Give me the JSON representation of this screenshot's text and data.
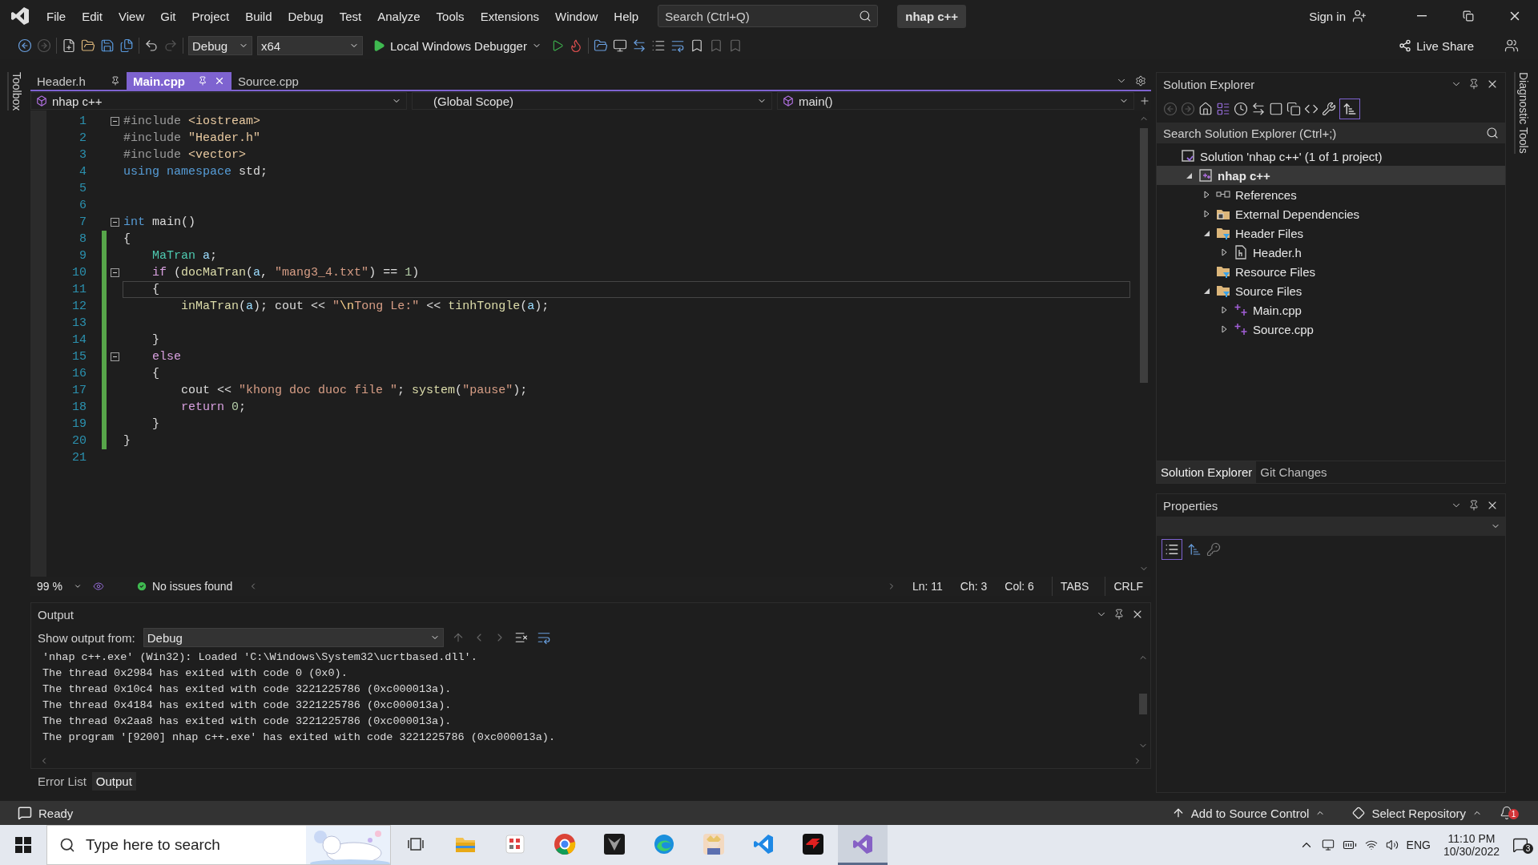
{
  "menu": [
    "File",
    "Edit",
    "View",
    "Git",
    "Project",
    "Build",
    "Debug",
    "Test",
    "Analyze",
    "Tools",
    "Extensions",
    "Window",
    "Help"
  ],
  "search": {
    "placeholder": "Search (Ctrl+Q)"
  },
  "solution_badge": "nhap c++",
  "sign_in": "Sign in",
  "toolbar": {
    "configuration": "Debug",
    "platform": "x64",
    "run": "Local Windows Debugger",
    "live_share": "Live Share"
  },
  "side_tabs": {
    "left": "Toolbox",
    "right": "Diagnostic Tools"
  },
  "editor": {
    "tabs": [
      {
        "label": "Header.h",
        "selected": false,
        "pinned": true
      },
      {
        "label": "Main.cpp",
        "selected": true,
        "pinned": true
      },
      {
        "label": "Source.cpp",
        "selected": false,
        "pinned": false
      }
    ],
    "project_scope": "nhap c++",
    "scope": "(Global Scope)",
    "member": "main()",
    "lines": [
      {
        "number": "1",
        "fold": true,
        "changed": false,
        "current": false,
        "tokens": [
          {
            "text": "#include ",
            "kind": "pre"
          },
          {
            "text": "<iostream>",
            "kind": "inc"
          }
        ]
      },
      {
        "number": "2",
        "fold": false,
        "changed": false,
        "current": false,
        "tokens": [
          {
            "text": "#include ",
            "kind": "pre"
          },
          {
            "text": "\"Header.h\"",
            "kind": "inc"
          }
        ]
      },
      {
        "number": "3",
        "fold": false,
        "changed": false,
        "current": false,
        "tokens": [
          {
            "text": "#include ",
            "kind": "pre"
          },
          {
            "text": "<vector>",
            "kind": "inc"
          }
        ]
      },
      {
        "number": "4",
        "fold": false,
        "changed": false,
        "current": false,
        "tokens": [
          {
            "text": "using namespace",
            "kind": "kw"
          },
          {
            "text": " std;",
            "kind": "txt"
          }
        ]
      },
      {
        "number": "5",
        "fold": false,
        "changed": false,
        "current": false
      },
      {
        "number": "6",
        "fold": false,
        "changed": false,
        "current": false
      },
      {
        "number": "7",
        "fold": true,
        "changed": false,
        "current": false,
        "tokens": [
          {
            "text": "int",
            "kind": "kw"
          },
          {
            "text": " main()",
            "kind": "txt"
          }
        ]
      },
      {
        "number": "8",
        "fold": false,
        "changed": true,
        "current": false,
        "tokens": [
          {
            "text": "{",
            "kind": "txt"
          }
        ]
      },
      {
        "number": "9",
        "fold": false,
        "changed": true,
        "current": false,
        "tokens": [
          {
            "text": "    MaTran",
            "kind": "type"
          },
          {
            "text": " a",
            "kind": "var"
          },
          {
            "text": ";",
            "kind": "txt"
          }
        ]
      },
      {
        "number": "10",
        "fold": true,
        "changed": true,
        "current": false,
        "tokens": [
          {
            "text": "    if",
            "kind": "ctl"
          },
          {
            "text": " (",
            "kind": "txt"
          },
          {
            "text": "docMaTran",
            "kind": "fn"
          },
          {
            "text": "(",
            "kind": "txt"
          },
          {
            "text": "a",
            "kind": "var"
          },
          {
            "text": ", ",
            "kind": "txt"
          },
          {
            "text": "\"mang3_4.txt\"",
            "kind": "str"
          },
          {
            "text": ") == ",
            "kind": "txt"
          },
          {
            "text": "1",
            "kind": "num"
          },
          {
            "text": ")",
            "kind": "txt"
          }
        ]
      },
      {
        "number": "11",
        "fold": false,
        "changed": true,
        "current": true,
        "tokens": [
          {
            "text": "    {",
            "kind": "txt"
          }
        ]
      },
      {
        "number": "12",
        "fold": false,
        "changed": true,
        "current": false,
        "tokens": [
          {
            "text": "        inMaTran",
            "kind": "fn"
          },
          {
            "text": "(",
            "kind": "txt"
          },
          {
            "text": "a",
            "kind": "var"
          },
          {
            "text": "); cout << ",
            "kind": "txt"
          },
          {
            "text": "\"",
            "kind": "str"
          },
          {
            "text": "\\n",
            "kind": "esc"
          },
          {
            "text": "Tong Le:\"",
            "kind": "str"
          },
          {
            "text": " << ",
            "kind": "txt"
          },
          {
            "text": "tinhTongle",
            "kind": "fn"
          },
          {
            "text": "(",
            "kind": "txt"
          },
          {
            "text": "a",
            "kind": "var"
          },
          {
            "text": ");",
            "kind": "txt"
          }
        ]
      },
      {
        "number": "13",
        "fold": false,
        "changed": true,
        "current": false
      },
      {
        "number": "14",
        "fold": false,
        "changed": true,
        "current": false,
        "tokens": [
          {
            "text": "    }",
            "kind": "txt"
          }
        ]
      },
      {
        "number": "15",
        "fold": true,
        "changed": true,
        "current": false,
        "tokens": [
          {
            "text": "    else",
            "kind": "ctl"
          }
        ]
      },
      {
        "number": "16",
        "fold": false,
        "changed": true,
        "current": false,
        "tokens": [
          {
            "text": "    {",
            "kind": "txt"
          }
        ]
      },
      {
        "number": "17",
        "fold": false,
        "changed": true,
        "current": false,
        "tokens": [
          {
            "text": "        cout << ",
            "kind": "txt"
          },
          {
            "text": "\"khong doc duoc file \"",
            "kind": "str"
          },
          {
            "text": "; ",
            "kind": "txt"
          },
          {
            "text": "system",
            "kind": "fn"
          },
          {
            "text": "(",
            "kind": "txt"
          },
          {
            "text": "\"pause\"",
            "kind": "str"
          },
          {
            "text": ");",
            "kind": "txt"
          }
        ]
      },
      {
        "number": "18",
        "fold": false,
        "changed": true,
        "current": false,
        "tokens": [
          {
            "text": "        return",
            "kind": "ctl"
          },
          {
            "text": " 0",
            "kind": "num"
          },
          {
            "text": ";",
            "kind": "txt"
          }
        ]
      },
      {
        "number": "19",
        "fold": false,
        "changed": true,
        "current": false,
        "tokens": [
          {
            "text": "    }",
            "kind": "txt"
          }
        ]
      },
      {
        "number": "20",
        "fold": false,
        "changed": true,
        "current": false,
        "tokens": [
          {
            "text": "}",
            "kind": "txt"
          }
        ]
      },
      {
        "number": "21",
        "fold": false,
        "changed": false,
        "current": false
      }
    ],
    "zoom": "99 %",
    "issues": "No issues found",
    "position": [
      "Ln: 11",
      "Ch: 3",
      "Col: 6"
    ],
    "indent": "TABS",
    "line_ending": "CRLF"
  },
  "output": {
    "title": "Output",
    "source_label": "Show output from:",
    "source": "Debug",
    "lines": [
      "'nhap c++.exe' (Win32): Loaded 'C:\\Windows\\System32\\ucrtbased.dll'.",
      "The thread 0x2984 has exited with code 0 (0x0).",
      "The thread 0x10c4 has exited with code 3221225786 (0xc000013a).",
      "The thread 0x4184 has exited with code 3221225786 (0xc000013a).",
      "The thread 0x2aa8 has exited with code 3221225786 (0xc000013a).",
      "The program '[9200] nhap c++.exe' has exited with code 3221225786 (0xc000013a)."
    ]
  },
  "bottom_tabs": [
    {
      "label": "Error List",
      "selected": false
    },
    {
      "label": "Output",
      "selected": true
    }
  ],
  "solution_explorer": {
    "title": "Solution Explorer",
    "preview_selected": true,
    "search": {
      "placeholder": "Search Solution Explorer (Ctrl+;)"
    },
    "tree": [
      {
        "label": "Solution 'nhap c++' (1 of 1 project)",
        "kind": "solution",
        "expandable": false,
        "expanded": true,
        "selected": false,
        "children": [
          {
            "label": "nhap c++",
            "kind": "project",
            "expandable": true,
            "expanded": true,
            "selected": true,
            "children": [
              {
                "label": "References",
                "kind": "references",
                "expandable": true,
                "expanded": false,
                "selected": false
              },
              {
                "label": "External Dependencies",
                "kind": "external",
                "expandable": true,
                "expanded": false,
                "selected": false
              },
              {
                "label": "Header Files",
                "kind": "folder",
                "expandable": true,
                "expanded": true,
                "selected": false,
                "children": [
                  {
                    "label": "Header.h",
                    "kind": "header",
                    "expandable": true,
                    "expanded": false,
                    "selected": false
                  }
                ]
              },
              {
                "label": "Resource Files",
                "kind": "folder",
                "expandable": false,
                "expanded": false,
                "selected": false
              },
              {
                "label": "Source Files",
                "kind": "folder",
                "expandable": true,
                "expanded": true,
                "selected": false,
                "children": [
                  {
                    "label": "Main.cpp",
                    "kind": "cpp",
                    "expandable": true,
                    "expanded": false,
                    "selected": false
                  },
                  {
                    "label": "Source.cpp",
                    "kind": "cpp",
                    "expandable": true,
                    "expanded": false,
                    "selected": false
                  }
                ]
              }
            ]
          }
        ]
      }
    ],
    "tabs": [
      {
        "label": "Solution Explorer",
        "selected": true
      },
      {
        "label": "Git Changes",
        "selected": false
      }
    ]
  },
  "properties": {
    "title": "Properties",
    "categorized_selected": true
  },
  "status_bar": {
    "state": "Ready",
    "source_control": "Add to Source Control",
    "repository": "Select Repository",
    "notifications": "1"
  },
  "taskbar": {
    "search": {
      "placeholder": "Type here to search"
    },
    "apps": [
      {
        "kind": "taskview",
        "active": false
      },
      {
        "kind": "folder",
        "active": false
      },
      {
        "kind": "grid",
        "active": false
      },
      {
        "kind": "chrome",
        "active": false
      },
      {
        "kind": "dark",
        "active": false
      },
      {
        "kind": "edge",
        "active": false
      },
      {
        "kind": "game",
        "active": false
      },
      {
        "kind": "vscode",
        "active": false
      },
      {
        "kind": "red",
        "active": false
      },
      {
        "kind": "vs",
        "active": true
      }
    ],
    "language": "ENG",
    "time": "11:10 PM",
    "date": "10/30/2022",
    "notifications": "3"
  }
}
